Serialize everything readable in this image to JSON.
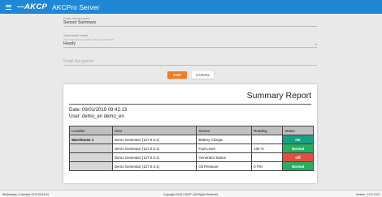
{
  "header": {
    "logo": "AKCP",
    "title": "AKCPro Server"
  },
  "form": {
    "report_name": {
      "label": "Enter report name",
      "value": "Sensor Summary"
    },
    "automated_email": {
      "label": "Automated email",
      "hint": "How often do you want to email your report?",
      "value": "Hourly"
    },
    "recipients": {
      "placeholder": "Email Recipients"
    }
  },
  "buttons": {
    "exit": "EXIT",
    "cancel": "CANCEL"
  },
  "report": {
    "title": "Summary Report",
    "date": "Date: 09/01/2019 09:42:13",
    "user": "User: demo_en demo_en",
    "columns": [
      "Location",
      "Host",
      "Sensor",
      "Reading",
      "Status"
    ],
    "rows": [
      {
        "location": "Warehouse 1",
        "host": "Demo Generator (127.0.0.1)",
        "sensor": "Battery Charge",
        "reading": "",
        "status": "OK",
        "status_color": "#16a085"
      },
      {
        "location": "",
        "host": "Demo Generator (127.0.0.1)",
        "sensor": "Fuel Level",
        "reading": "100 %",
        "status": "Normal",
        "status_color": "#27ae60"
      },
      {
        "location": "",
        "host": "Demo Generator (127.0.0.1)",
        "sensor": "Generator Status",
        "reading": "",
        "status": "Off",
        "status_color": "#e74c3c"
      },
      {
        "location": "",
        "host": "Demo Generator (127.0.0.1)",
        "sensor": "Oil Pressure",
        "reading": "0 PSI",
        "status": "Normal",
        "status_color": "#27ae60"
      }
    ]
  },
  "footer": {
    "left": "Wednesday, 9 January 2019 09:42:34",
    "center": "Copyright 2018 | AKCP | All Rights Reserved",
    "right": "Version : 13.0.1703"
  },
  "colors": {
    "header_bg": "#1e88d6",
    "exit_button": "#f47b1f"
  }
}
